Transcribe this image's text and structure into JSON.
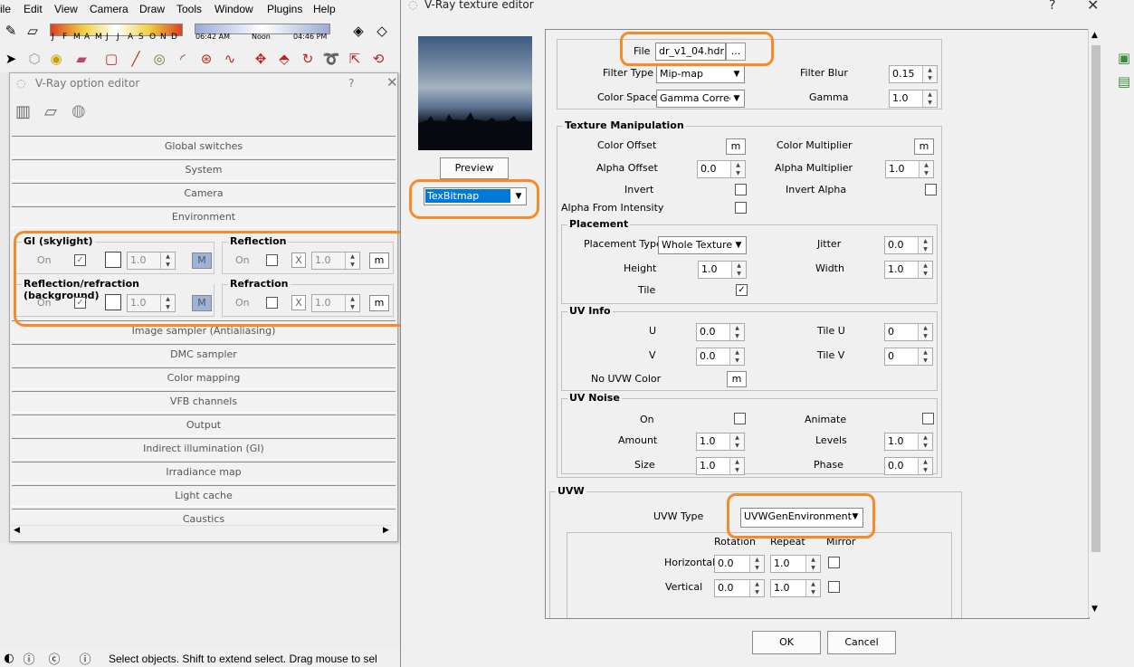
{
  "sketchup": {
    "menu": [
      "ile",
      "Edit",
      "View",
      "Camera",
      "Draw",
      "Tools",
      "Window",
      "Plugins",
      "Help"
    ],
    "months": [
      "J",
      "F",
      "M",
      "A",
      "M",
      "J",
      "J",
      "A",
      "S",
      "O",
      "N",
      "D"
    ],
    "time_start": "06:42 AM",
    "time_noon": "Noon",
    "time_end": "04:46 PM",
    "status_text": "Select objects. Shift to extend select. Drag mouse to sel"
  },
  "option_editor": {
    "title": "V-Ray option editor",
    "help": "?",
    "close": "✕",
    "rollouts_top": [
      "Global switches",
      "System",
      "Camera",
      "Environment"
    ],
    "gi": {
      "title": "GI (skylight)",
      "on_label": "On",
      "checked": "✓",
      "value": "1.0",
      "m": "M"
    },
    "reflection": {
      "title": "Reflection",
      "on_label": "On",
      "x": "X",
      "value": "1.0",
      "m": "m"
    },
    "refl_refr": {
      "title": "Reflection/refraction (background)",
      "on_label": "On",
      "checked": "✓",
      "value": "1.0",
      "m": "M"
    },
    "refraction": {
      "title": "Refraction",
      "on_label": "On",
      "x": "X",
      "value": "1.0",
      "m": "m"
    },
    "rollouts_bottom": [
      "Image sampler (Antialiasing)",
      "DMC sampler",
      "Color mapping",
      "VFB channels",
      "Output",
      "Indirect illumination (GI)",
      "Irradiance map",
      "Light cache",
      "Caustics"
    ]
  },
  "texture_editor": {
    "title": "V-Ray texture editor",
    "help": "?",
    "close": "✕",
    "preview_button": "Preview",
    "texture_type": "TexBitmap",
    "file_label": "File",
    "file_value": "dr_v1_04.hdr",
    "browse": "...",
    "filter_type_label": "Filter Type",
    "filter_type": "Mip-map",
    "filter_blur_label": "Filter Blur",
    "filter_blur": "0.15",
    "color_space_label": "Color Space",
    "color_space": "Gamma Correcte",
    "gamma_label": "Gamma",
    "gamma": "1.0",
    "texman": {
      "title": "Texture Manipulation",
      "color_offset": "Color Offset",
      "color_multiplier": "Color Multiplier",
      "m": "m",
      "alpha_offset": "Alpha Offset",
      "alpha_offset_v": "0.0",
      "alpha_multiplier": "Alpha Multiplier",
      "alpha_multiplier_v": "1.0",
      "invert": "Invert",
      "invert_alpha": "Invert Alpha",
      "alpha_from_intensity": "Alpha From Intensity"
    },
    "placement": {
      "title": "Placement",
      "type_label": "Placement Type",
      "type": "Whole Texture",
      "jitter": "Jitter",
      "jitter_v": "0.0",
      "height": "Height",
      "height_v": "1.0",
      "width": "Width",
      "width_v": "1.0",
      "tile": "Tile",
      "tile_check": "✓"
    },
    "uvinfo": {
      "title": "UV Info",
      "u": "U",
      "u_v": "0.0",
      "tile_u": "Tile U",
      "tile_u_v": "0",
      "v": "V",
      "v_v": "0.0",
      "tile_v": "Tile V",
      "tile_v_v": "0",
      "no_uvw_color": "No UVW Color",
      "m": "m"
    },
    "uvnoise": {
      "title": "UV Noise",
      "on": "On",
      "animate": "Animate",
      "amount": "Amount",
      "amount_v": "1.0",
      "levels": "Levels",
      "levels_v": "1.0",
      "size": "Size",
      "size_v": "1.0",
      "phase": "Phase",
      "phase_v": "0.0"
    },
    "uvw": {
      "title": "UVW",
      "type_label": "UVW Type",
      "type": "UVWGenEnvironment",
      "col_rotation": "Rotation",
      "col_repeat": "Repeat",
      "col_mirror": "Mirror",
      "horizontal": "Horizontal",
      "h_rot": "0.0",
      "h_rep": "1.0",
      "vertical": "Vertical",
      "v_rot": "0.0",
      "v_rep": "1.0"
    },
    "ok": "OK",
    "cancel": "Cancel"
  },
  "colors": {
    "highlight": "#f58a2a",
    "selection": "#0078d7"
  }
}
